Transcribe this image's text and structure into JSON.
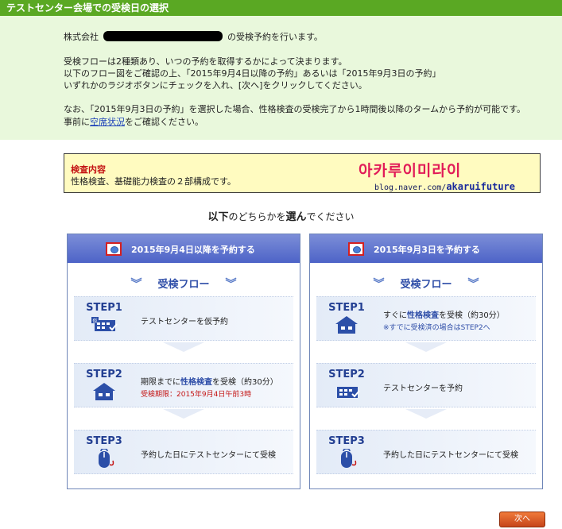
{
  "title_bar": "テストセンター会場での受検日の選択",
  "intro": {
    "company_prefix": "株式会社",
    "company_suffix": "の受検予約を行います。",
    "p1_l1": "受検フローは2種類あり、いつの予約を取得するかによって決まります。",
    "p1_l2": "以下のフロー図をご確認の上、「2015年9月4日以降の予約」あるいは「2015年9月3日の予約」",
    "p1_l3": "いずれかのラジオボタンにチェックを入れ、[次へ]をクリックしてください。",
    "p2_l1": "なお、「2015年9月3日の予約」を選択した場合、性格検査の受検完了から1時間後以降のタームから予約が可能です。",
    "p2_l2_pre": "事前に",
    "p2_l2_link": "空席状況",
    "p2_l2_post": "をご確認ください。"
  },
  "notice": {
    "title": "検査内容",
    "body": "性格検査、基礎能力検査の２部構成です。",
    "watermark_kr": "아카루이미라이",
    "watermark_url_pre": "blog.naver.com/",
    "watermark_url_name": "akaruifuture"
  },
  "choose": {
    "pre": "以下",
    "mid": "のどちらかを",
    "bold2": "選ん",
    "post": "でください"
  },
  "left_panel": {
    "label": "2015年9月4日以降を予約する",
    "flow_title": "受検フロー",
    "steps": [
      {
        "no": "STEP1",
        "text": "テストセンターを仮予約"
      },
      {
        "no": "STEP2",
        "text_pre": "期限までに",
        "text_emph": "性格検査",
        "text_post": "を受検（約30分）",
        "sub": "受検期限：2015年9月4日午前3時"
      },
      {
        "no": "STEP3",
        "text": "予約した日にテストセンターにて受検"
      }
    ]
  },
  "right_panel": {
    "label": "2015年9月3日を予約する",
    "flow_title": "受検フロー",
    "steps": [
      {
        "no": "STEP1",
        "text_pre": "すぐに",
        "text_emph": "性格検査",
        "text_post": "を受検（約30分）",
        "sub": "※すでに受検済の場合はSTEP2へ"
      },
      {
        "no": "STEP2",
        "text": "テストセンターを予約"
      },
      {
        "no": "STEP3",
        "text": "予約した日にテストセンターにて受検"
      }
    ]
  },
  "next_label": "次へ",
  "icons": {
    "calendar": "calendar-check-icon",
    "building": "building-icon",
    "mouse": "mouse-icon",
    "chevron": "chevron-down-icon",
    "radio": "radio-button"
  }
}
